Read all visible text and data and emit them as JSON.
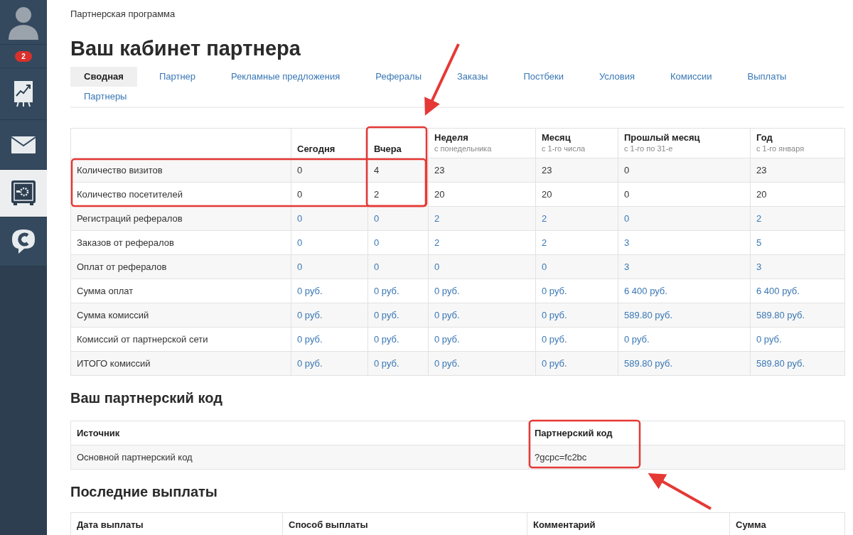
{
  "sidebar": {
    "items": [
      {
        "kind": "avatar",
        "selected": false
      },
      {
        "kind": "badge",
        "count": "2",
        "selected": false
      },
      {
        "kind": "chart",
        "selected": false
      },
      {
        "kind": "mail",
        "selected": false
      },
      {
        "kind": "safe",
        "selected": true
      },
      {
        "kind": "chat",
        "selected": false
      }
    ]
  },
  "breadcrumb": "Партнерская программа",
  "title": "Ваш кабинет партнера",
  "tabs": [
    {
      "label": "Сводная",
      "selected": true
    },
    {
      "label": "Партнер",
      "selected": false
    },
    {
      "label": "Рекламные предложения",
      "selected": false
    },
    {
      "label": "Рефералы",
      "selected": false
    },
    {
      "label": "Заказы",
      "selected": false
    },
    {
      "label": "Постбеки",
      "selected": false
    },
    {
      "label": "Условия",
      "selected": false
    },
    {
      "label": "Комиссии",
      "selected": false
    },
    {
      "label": "Выплаты",
      "selected": false
    },
    {
      "label": "Партнеры",
      "selected": false
    }
  ],
  "stats_table": {
    "columns": [
      {
        "title": "Сегодня"
      },
      {
        "title": "Вчера"
      },
      {
        "title": "Неделя",
        "subtitle": "с понедельника"
      },
      {
        "title": "Месяц",
        "subtitle": "с 1-го числа"
      },
      {
        "title": "Прошлый месяц",
        "subtitle": "с 1-го по 31-е"
      },
      {
        "title": "Год",
        "subtitle": "с 1-го января"
      }
    ],
    "rows": [
      {
        "label": "Количество визитов",
        "linked": false,
        "values": [
          "0",
          "4",
          "23",
          "23",
          "0",
          "23"
        ]
      },
      {
        "label": "Количество посетителей",
        "linked": false,
        "values": [
          "0",
          "2",
          "20",
          "20",
          "0",
          "20"
        ]
      },
      {
        "label": "Регистраций рефералов",
        "linked": true,
        "values": [
          "0",
          "0",
          "2",
          "2",
          "0",
          "2"
        ]
      },
      {
        "label": "Заказов от рефералов",
        "linked": true,
        "values": [
          "0",
          "0",
          "2",
          "2",
          "3",
          "5"
        ]
      },
      {
        "label": "Оплат от рефералов",
        "linked": true,
        "values": [
          "0",
          "0",
          "0",
          "0",
          "3",
          "3"
        ]
      },
      {
        "label": "Сумма оплат",
        "linked": true,
        "values": [
          "0 руб.",
          "0 руб.",
          "0 руб.",
          "0 руб.",
          "6 400 руб.",
          "6 400 руб."
        ]
      },
      {
        "label": "Сумма комиссий",
        "linked": true,
        "values": [
          "0 руб.",
          "0 руб.",
          "0 руб.",
          "0 руб.",
          "589.80 руб.",
          "589.80 руб."
        ]
      },
      {
        "label": "Комиссий от партнерской сети",
        "linked": true,
        "values": [
          "0 руб.",
          "0 руб.",
          "0 руб.",
          "0 руб.",
          "0 руб.",
          "0 руб."
        ]
      },
      {
        "label": "ИТОГО комиссий",
        "linked": true,
        "values": [
          "0 руб.",
          "0 руб.",
          "0 руб.",
          "0 руб.",
          "589.80 руб.",
          "589.80 руб."
        ]
      }
    ]
  },
  "code_section": {
    "heading": "Ваш партнерский код",
    "columns": [
      "Источник",
      "Партнерский код"
    ],
    "rows": [
      [
        "Основной партнерский код",
        "?gcpc=fc2bc"
      ]
    ]
  },
  "payouts_section": {
    "heading": "Последние выплаты",
    "columns": [
      "Дата выплаты",
      "Способ выплаты",
      "Комментарий",
      "Сумма"
    ]
  }
}
